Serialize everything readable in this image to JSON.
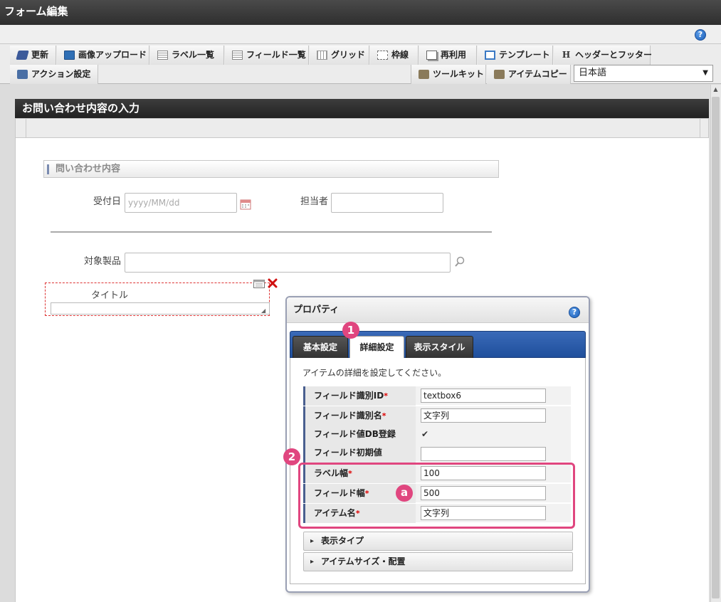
{
  "window": {
    "title": "フォーム編集"
  },
  "toolbar": {
    "row1": [
      {
        "label": "更新",
        "icon": "edit-icon"
      },
      {
        "label": "画像アップロード",
        "icon": "image-icon"
      },
      {
        "label": "ラベル一覧",
        "icon": "list-icon"
      },
      {
        "label": "フィールド一覧",
        "icon": "list-icon"
      },
      {
        "label": "グリッド",
        "icon": "grid-icon"
      },
      {
        "label": "枠線",
        "icon": "frame-icon"
      },
      {
        "label": "再利用",
        "icon": "copy-icon"
      },
      {
        "label": "テンプレート",
        "icon": "template-icon"
      },
      {
        "label": "ヘッダーとフッター",
        "icon": "h-icon",
        "glyph": "H"
      }
    ],
    "row2_left": [
      {
        "label": "アクション設定",
        "icon": "action-icon"
      }
    ],
    "row2_right": [
      {
        "label": "ツールキット",
        "icon": "toolkit-icon"
      },
      {
        "label": "アイテムコピー",
        "icon": "toolkit-icon"
      }
    ],
    "language": "日本語",
    "help_glyph": "?"
  },
  "form": {
    "title": "お問い合わせ内容の入力",
    "section_title": "問い合わせ内容",
    "fields": {
      "receipt_date": {
        "label": "受付日",
        "placeholder": "yyyy/MM/dd"
      },
      "assignee": {
        "label": "担当者",
        "value": ""
      },
      "product": {
        "label": "対象製品",
        "value": ""
      },
      "title": {
        "label": "タイトル",
        "value": ""
      }
    }
  },
  "properties": {
    "title": "プロパティ",
    "help_glyph": "?",
    "tabs": [
      "基本設定",
      "詳細設定",
      "表示スタイル"
    ],
    "active_tab": "詳細設定",
    "description": "アイテムの詳細を設定してください。",
    "rows": [
      {
        "label": "フィールド識別ID",
        "required": true,
        "type": "text",
        "value": "textbox6"
      },
      {
        "label": "フィールド識別名",
        "required": true,
        "type": "text",
        "value": "文字列"
      },
      {
        "label": "フィールド値DB登録",
        "required": false,
        "type": "checkbox",
        "value": "✔"
      },
      {
        "label": "フィールド初期値",
        "required": false,
        "type": "text",
        "value": ""
      },
      {
        "label": "ラベル幅",
        "required": true,
        "type": "text",
        "value": "100"
      },
      {
        "label": "フィールド幅",
        "required": true,
        "type": "text",
        "value": "500"
      },
      {
        "label": "アイテム名",
        "required": true,
        "type": "text",
        "value": "文字列"
      }
    ],
    "required_mark": "*",
    "accordions": [
      "表示タイプ",
      "アイテムサイズ・配置"
    ]
  },
  "annotations": {
    "badge1": "1",
    "badge2": "2",
    "badge_a": "a"
  },
  "colors": {
    "highlight": "#e0467f",
    "tab_bar": "#1f4f9c",
    "delete": "#d01010"
  }
}
